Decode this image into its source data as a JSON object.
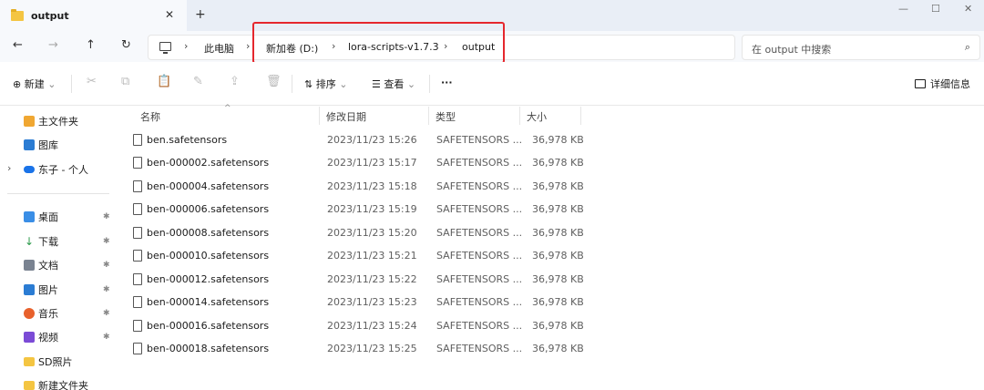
{
  "window": {
    "tab_title": "output",
    "tab_close": "✕",
    "new_tab": "+",
    "controls": {
      "minimize": "—",
      "maximize": "☐",
      "close": "✕"
    }
  },
  "nav": {
    "back": "←",
    "forward": "→",
    "up": "↑",
    "refresh": "↻",
    "breadcrumb": [
      "此电脑",
      "新加卷 (D:)",
      "lora-scripts-v1.7.3",
      "output"
    ],
    "separator": "›",
    "search_placeholder": "在 output 中搜索",
    "search_icon": "⌕"
  },
  "toolbar": {
    "new_label": "新建",
    "new_icon": "⊕",
    "sort_label": "排序",
    "sort_icon": "⇅",
    "view_label": "查看",
    "view_icon": "☰",
    "more": "···",
    "details_label": "详细信息",
    "dropdown_chevron": "⌄",
    "disabled_icons": [
      "cut-icon",
      "copy-icon",
      "paste-icon",
      "rename-icon",
      "share-icon",
      "delete-icon"
    ]
  },
  "sidebar": {
    "top_items": [
      {
        "label": "主文件夹",
        "icon": "home-icon",
        "color": "#f0a732"
      },
      {
        "label": "图库",
        "icon": "gallery-icon",
        "color": "#2b7cd3"
      },
      {
        "label": "东子 - 个人",
        "icon": "onedrive-icon",
        "color": "#1a73e8",
        "expand": "›"
      }
    ],
    "quick_access": [
      {
        "label": "桌面",
        "icon": "desktop-icon",
        "color": "#3a8ee6",
        "pinned": true
      },
      {
        "label": "下载",
        "icon": "download-icon",
        "color": "#2b9a4a",
        "pinned": true
      },
      {
        "label": "文档",
        "icon": "documents-icon",
        "color": "#7a8391",
        "pinned": true
      },
      {
        "label": "图片",
        "icon": "pictures-icon",
        "color": "#2b7cd3",
        "pinned": true
      },
      {
        "label": "音乐",
        "icon": "music-icon",
        "color": "#e8612c",
        "pinned": true
      },
      {
        "label": "视频",
        "icon": "videos-icon",
        "color": "#7b4bd6",
        "pinned": true
      },
      {
        "label": "SD照片",
        "icon": "folder-icon",
        "color": "#f4c542",
        "pinned": false
      },
      {
        "label": "新建文件夹",
        "icon": "folder-icon",
        "color": "#f4c542",
        "pinned": false
      }
    ],
    "pin_glyph": "✱"
  },
  "list": {
    "columns": [
      "名称",
      "修改日期",
      "类型",
      "大小"
    ],
    "sort_caret": "^",
    "files": [
      {
        "name": "ben.safetensors",
        "date": "2023/11/23 15:26",
        "type": "SAFETENSORS ...",
        "size": "36,978 KB"
      },
      {
        "name": "ben-000002.safetensors",
        "date": "2023/11/23 15:17",
        "type": "SAFETENSORS ...",
        "size": "36,978 KB"
      },
      {
        "name": "ben-000004.safetensors",
        "date": "2023/11/23 15:18",
        "type": "SAFETENSORS ...",
        "size": "36,978 KB"
      },
      {
        "name": "ben-000006.safetensors",
        "date": "2023/11/23 15:19",
        "type": "SAFETENSORS ...",
        "size": "36,978 KB"
      },
      {
        "name": "ben-000008.safetensors",
        "date": "2023/11/23 15:20",
        "type": "SAFETENSORS ...",
        "size": "36,978 KB"
      },
      {
        "name": "ben-000010.safetensors",
        "date": "2023/11/23 15:21",
        "type": "SAFETENSORS ...",
        "size": "36,978 KB"
      },
      {
        "name": "ben-000012.safetensors",
        "date": "2023/11/23 15:22",
        "type": "SAFETENSORS ...",
        "size": "36,978 KB"
      },
      {
        "name": "ben-000014.safetensors",
        "date": "2023/11/23 15:23",
        "type": "SAFETENSORS ...",
        "size": "36,978 KB"
      },
      {
        "name": "ben-000016.safetensors",
        "date": "2023/11/23 15:24",
        "type": "SAFETENSORS ...",
        "size": "36,978 KB"
      },
      {
        "name": "ben-000018.safetensors",
        "date": "2023/11/23 15:25",
        "type": "SAFETENSORS ...",
        "size": "36,978 KB"
      }
    ]
  },
  "annotation": {
    "highlight_color": "#e5272d"
  }
}
